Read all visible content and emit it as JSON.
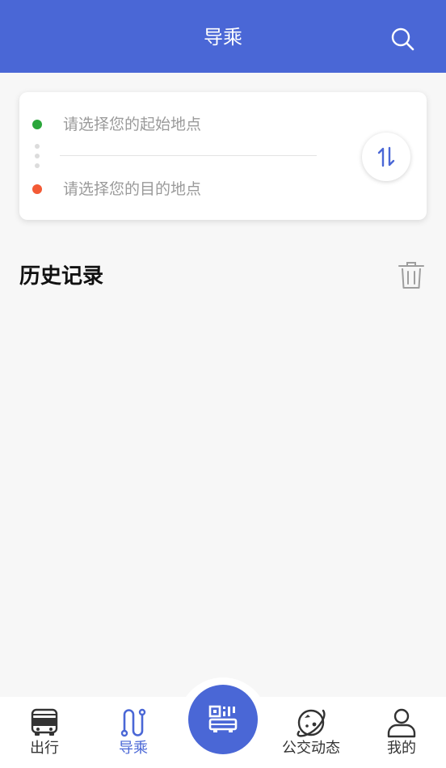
{
  "header": {
    "title": "导乘",
    "search_icon": "search-icon"
  },
  "route": {
    "start_placeholder": "请选择您的起始地点",
    "end_placeholder": "请选择您的目的地点",
    "start_dot_color": "#2aa63a",
    "end_dot_color": "#f35a35",
    "swap_icon": "swap-arrows-icon"
  },
  "history": {
    "title": "历史记录",
    "clear_icon": "trash-icon"
  },
  "tabbar": {
    "tabs": [
      {
        "label": "出行",
        "icon": "bus-front-icon",
        "active": false
      },
      {
        "label": "导乘",
        "icon": "route-icon",
        "active": true
      },
      {
        "label": "",
        "icon": "qr-bus-code-icon",
        "active": false
      },
      {
        "label": "公交动态",
        "icon": "compass-planet-icon",
        "active": false
      },
      {
        "label": "我的",
        "icon": "user-icon",
        "active": false
      }
    ]
  },
  "colors": {
    "brand": "#4a67d6",
    "background": "#f7f7f7"
  }
}
